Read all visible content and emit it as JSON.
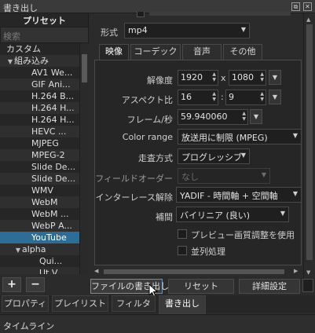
{
  "window": {
    "title": "書き出し"
  },
  "left": {
    "preset_title": "プリセット",
    "search_placeholder": "検索",
    "tree": [
      {
        "label": "カスタム",
        "indent": 1,
        "arrow": ""
      },
      {
        "label": "組み込み",
        "indent": 1,
        "arrow": "▼"
      },
      {
        "label": "AV1 We...",
        "indent": 3,
        "arrow": ""
      },
      {
        "label": "GIF Ani...",
        "indent": 3,
        "arrow": ""
      },
      {
        "label": "H.264 B...",
        "indent": 3,
        "arrow": ""
      },
      {
        "label": "H.264 H...",
        "indent": 3,
        "arrow": ""
      },
      {
        "label": "H.264 H...",
        "indent": 3,
        "arrow": ""
      },
      {
        "label": "HEVC ...",
        "indent": 3,
        "arrow": ""
      },
      {
        "label": "MJPEG",
        "indent": 3,
        "arrow": ""
      },
      {
        "label": "MPEG-2",
        "indent": 3,
        "arrow": ""
      },
      {
        "label": "Slide De...",
        "indent": 3,
        "arrow": ""
      },
      {
        "label": "Slide De...",
        "indent": 3,
        "arrow": ""
      },
      {
        "label": "WMV",
        "indent": 3,
        "arrow": ""
      },
      {
        "label": "WebM",
        "indent": 3,
        "arrow": ""
      },
      {
        "label": "WebM ...",
        "indent": 3,
        "arrow": ""
      },
      {
        "label": "WebP A...",
        "indent": 3,
        "arrow": ""
      },
      {
        "label": "YouTube",
        "indent": 3,
        "arrow": "",
        "selected": true
      },
      {
        "label": "alpha",
        "indent": 2,
        "arrow": "▼"
      },
      {
        "label": "Qui...",
        "indent": 4,
        "arrow": ""
      },
      {
        "label": "Ut V...",
        "indent": 4,
        "arrow": ""
      }
    ]
  },
  "form": {
    "format_label": "形式",
    "format_value": "mp4",
    "tabs": [
      "映像",
      "コーデック",
      "音声",
      "その他"
    ],
    "resolution_label": "解像度",
    "resolution_w": "1920",
    "resolution_x": "x",
    "resolution_h": "1080",
    "aspect_label": "アスペクト比",
    "aspect_w": "16",
    "aspect_sep": ":",
    "aspect_h": "9",
    "fps_label": "フレーム/秒",
    "fps_value": "59.940060",
    "color_range_label": "Color range",
    "color_range_value": "放送用に制限 (MPEG)",
    "scan_label": "走査方式",
    "scan_value": "プログレッシブ",
    "field_order_label": "フィールドオーダー",
    "field_order_value": "なし",
    "deinterlace_label": "インターレース解除",
    "deinterlace_value": "YADIF - 時間軸 + 空間軸",
    "interp_label": "補間",
    "interp_value": "バイリニア (良い)",
    "preview_scale_label": "プレビュー画質調整を使用",
    "parallel_label": "並列処理"
  },
  "buttons": {
    "add": "+",
    "remove": "−",
    "export_file": "ファイルの書き出し",
    "reset": "リセット",
    "advanced": "詳細設定"
  },
  "bottom_tabs": [
    "プロパティ",
    "プレイリスト",
    "フィルタ",
    "書き出し"
  ],
  "timeline_label": "タイムライン"
}
